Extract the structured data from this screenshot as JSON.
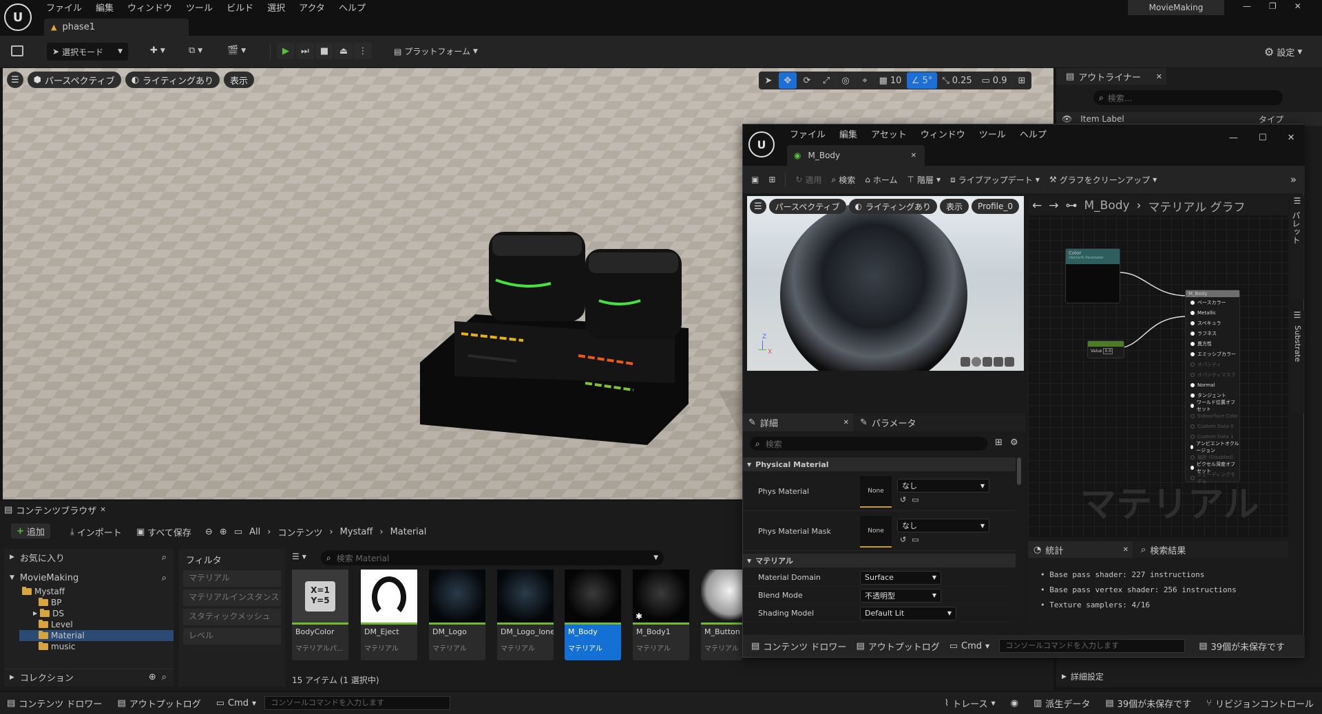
{
  "app": {
    "menu": [
      "ファイル",
      "編集",
      "ウィンドウ",
      "ツール",
      "ビルド",
      "選択",
      "アクタ",
      "ヘルプ"
    ],
    "project_name": "MovieMaking",
    "level_tab": "phase1"
  },
  "toolbar": {
    "select_mode": "選択モード",
    "platform": "プラットフォーム",
    "settings": "設定"
  },
  "viewport": {
    "perspective": "パースペクティブ",
    "lighting": "ライティングあり",
    "show": "表示",
    "grid_size": "10",
    "rot_snap": "5°",
    "scale_snap": "0.25",
    "camera_speed": "0.9"
  },
  "outliner": {
    "title": "アウトライナー",
    "search_placeholder": "検索...",
    "col_label": "Item Label",
    "col_type": "タイプ",
    "details_settings": "詳細設定"
  },
  "content_browser": {
    "tab": "コンテンツブラウザ",
    "add": "追加",
    "import": "インポート",
    "save_all": "すべて保存",
    "breadcrumb": [
      "All",
      "コンテンツ",
      "Mystaff",
      "Material"
    ],
    "favorites": "お気に入り",
    "project": "MovieMaking",
    "collections": "コレクション",
    "tree": [
      "Mystaff",
      "BP",
      "DS",
      "Level",
      "Material",
      "music"
    ],
    "filters_title": "フィルタ",
    "filters": [
      "マテリアル",
      "マテリアルインスタンス",
      "スタティックメッシュ",
      "レベル"
    ],
    "search_placeholder": "検索 Material",
    "assets": [
      {
        "name": "BodyColor",
        "type": "マテリアルパ..."
      },
      {
        "name": "DM_Eject",
        "type": "マテリアル"
      },
      {
        "name": "DM_Logo",
        "type": "マテリアル"
      },
      {
        "name": "DM_Logo_lone",
        "type": "マテリアル"
      },
      {
        "name": "M_Body",
        "type": "マテリアル"
      },
      {
        "name": "M_Body1",
        "type": "マテリアル"
      },
      {
        "name": "M_Button",
        "type": "マテリアル"
      }
    ],
    "param_icon_text": "X=1 Y=5",
    "item_count": "15 アイテム (1 選択中)"
  },
  "material_editor": {
    "menu": [
      "ファイル",
      "編集",
      "アセット",
      "ウィンドウ",
      "ツール",
      "ヘルプ"
    ],
    "tab": "M_Body",
    "toolbar": {
      "apply": "適用",
      "search": "検索",
      "home": "ホーム",
      "hierarchy": "階層",
      "live_update": "ライブアップデート",
      "clean_graph": "グラフをクリーンアップ"
    },
    "preview": {
      "perspective": "パースペクティブ",
      "lighting": "ライティングあり",
      "show": "表示",
      "profile": "Profile_0"
    },
    "details_tab": "詳細",
    "params_tab": "パラメータ",
    "details_search": "検索",
    "section_physical": "Physical Material",
    "phys_material": "Phys Material",
    "phys_material_mask": "Phys Material Mask",
    "none_thumb": "None",
    "none_option": "なし",
    "section_material": "マテリアル",
    "material_domain_label": "Material Domain",
    "material_domain": "Surface",
    "blend_mode_label": "Blend Mode",
    "blend_mode": "不透明型",
    "shading_model_label": "Shading Model",
    "shading_model": "Default Lit",
    "graph_breadcrumb_asset": "M_Body",
    "graph_breadcrumb_graph": "マテリアル グラフ",
    "palette": "パレット",
    "substrate": "Substrate",
    "watermark": "マテリアル",
    "node_color_title": "Color",
    "node_color_sub": "(Vector4) Parameter",
    "node_value_label": "Value",
    "node_value": "0.0",
    "node_result_title": "M_Body",
    "node_pins": [
      {
        "label": "ベースカラー",
        "on": true
      },
      {
        "label": "Metallic",
        "on": true
      },
      {
        "label": "スペキュラ",
        "on": true
      },
      {
        "label": "ラフネス",
        "on": true
      },
      {
        "label": "異方性",
        "on": true
      },
      {
        "label": "エミッシブカラー",
        "on": true
      },
      {
        "label": "オパシティ",
        "on": false
      },
      {
        "label": "オパシティマスク",
        "on": false
      },
      {
        "label": "Normal",
        "on": true
      },
      {
        "label": "タンジェント",
        "on": true
      },
      {
        "label": "ワールド位置オフセット",
        "on": true
      },
      {
        "label": "Subsurface Color",
        "on": false
      },
      {
        "label": "Custom Data 0",
        "on": false
      },
      {
        "label": "Custom Data 1",
        "on": false
      },
      {
        "label": "アンビエントオクルージョン",
        "on": true
      },
      {
        "label": "屈折 (Disabled)",
        "on": false
      },
      {
        "label": "ピクセル深度オフセット",
        "on": true
      },
      {
        "label": "シェーディングモデル",
        "on": false
      }
    ],
    "stats_tab": "統計",
    "search_results_tab": "検索結果",
    "stats": [
      "Base pass shader: 227 instructions",
      "Base pass vertex shader: 256 instructions",
      "Texture samplers: 4/16"
    ],
    "content_drawer": "コンテンツ ドロワー",
    "output_log": "アウトプットログ",
    "cmd": "Cmd",
    "console_placeholder": "コンソールコマンドを入力します",
    "unsaved": "39個が未保存です"
  },
  "statusbar": {
    "content_drawer": "コンテンツ ドロワー",
    "output_log": "アウトプットログ",
    "cmd": "Cmd",
    "console_placeholder": "コンソールコマンドを入力します",
    "trace": "トレース",
    "derived_data": "派生データ",
    "unsaved": "39個が未保存です",
    "revision_control": "リビジョンコントロール"
  }
}
